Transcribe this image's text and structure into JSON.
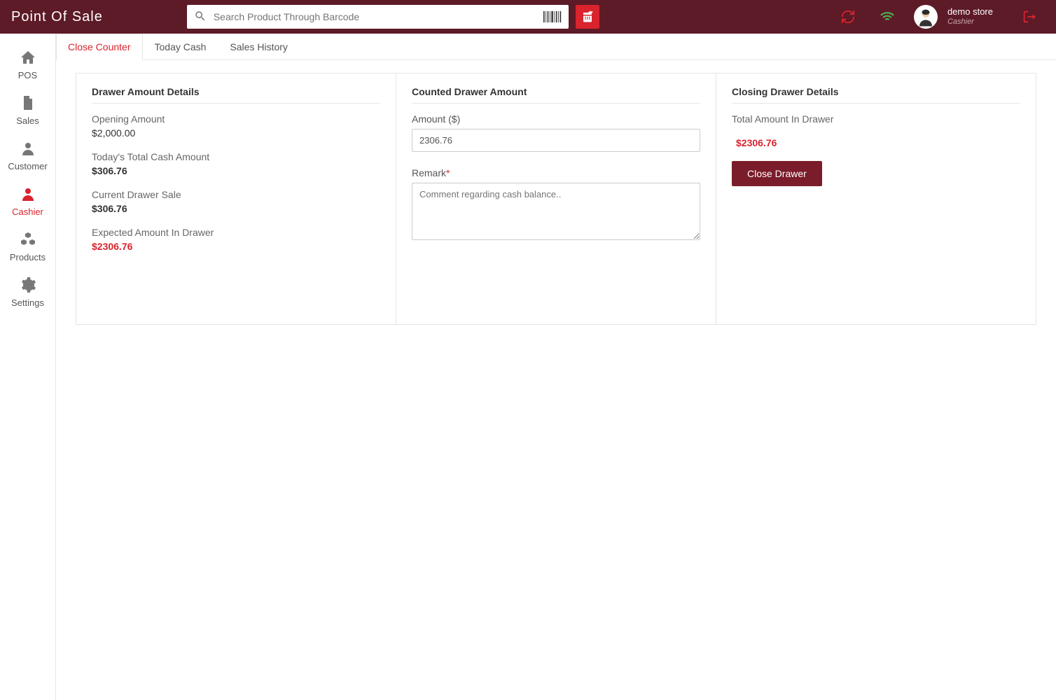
{
  "header": {
    "title": "Point Of Sale",
    "search_placeholder": "Search Product Through Barcode",
    "user_name": "demo store",
    "user_role": "Cashier"
  },
  "sidebar": {
    "items": [
      {
        "label": "POS"
      },
      {
        "label": "Sales"
      },
      {
        "label": "Customer"
      },
      {
        "label": "Cashier"
      },
      {
        "label": "Products"
      },
      {
        "label": "Settings"
      }
    ]
  },
  "tabs": [
    {
      "label": "Close Counter"
    },
    {
      "label": "Today Cash"
    },
    {
      "label": "Sales History"
    }
  ],
  "drawer_details": {
    "heading": "Drawer Amount Details",
    "opening_label": "Opening Amount",
    "opening_value": "$2,000.00",
    "today_cash_label": "Today's Total Cash Amount",
    "today_cash_value": "$306.76",
    "current_sale_label": "Current Drawer Sale",
    "current_sale_value": "$306.76",
    "expected_label": "Expected Amount In Drawer",
    "expected_value": "$2306.76"
  },
  "counted": {
    "heading": "Counted Drawer Amount",
    "amount_label": "Amount ($)",
    "amount_value": "2306.76",
    "remark_label": "Remark",
    "remark_placeholder": "Comment regarding cash balance.."
  },
  "closing": {
    "heading": "Closing Drawer Details",
    "total_label": "Total Amount In Drawer",
    "total_value": "$2306.76",
    "button": "Close Drawer"
  }
}
